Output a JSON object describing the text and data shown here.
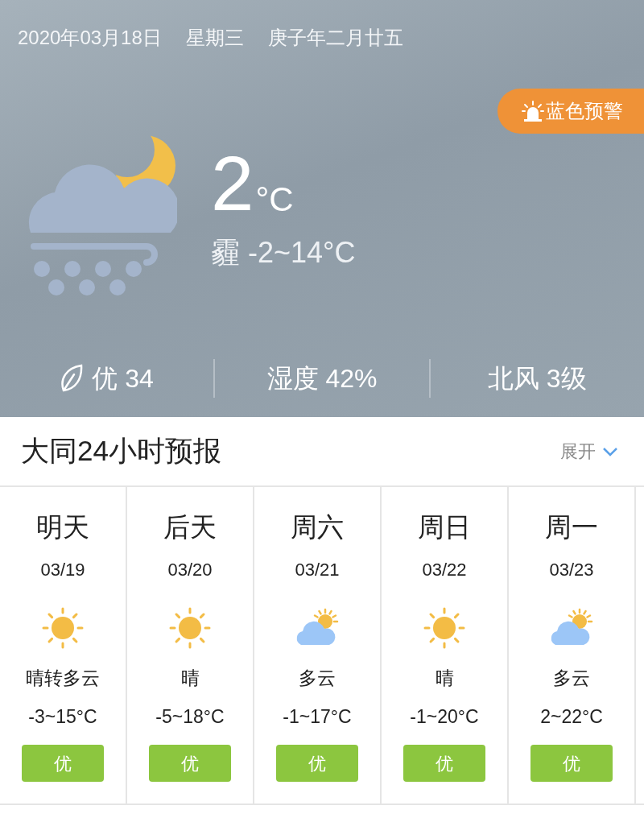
{
  "date_line": {
    "date": "2020年03月18日",
    "weekday": "星期三",
    "lunar": "庚子年二月廿五"
  },
  "alert": {
    "label": "蓝色预警"
  },
  "current": {
    "temperature": "2",
    "unit": "°C",
    "summary": "霾 -2~14°C"
  },
  "stats": [
    {
      "kind": "air",
      "text": "优 34"
    },
    {
      "kind": "plain",
      "text": "湿度 42%"
    },
    {
      "kind": "plain",
      "text": "北风 3级"
    }
  ],
  "forecast": {
    "title": "大同24小时预报",
    "expand_label": "展开",
    "days": [
      {
        "day": "明天",
        "date": "03/19",
        "kind": "sunny",
        "condition": "晴转多云",
        "range": "-3~15°C",
        "aqi": "优",
        "color": "#8cc63f"
      },
      {
        "day": "后天",
        "date": "03/20",
        "kind": "sunny",
        "condition": "晴",
        "range": "-5~18°C",
        "aqi": "优",
        "color": "#8cc63f"
      },
      {
        "day": "周六",
        "date": "03/21",
        "kind": "cloudy",
        "condition": "多云",
        "range": "-1~17°C",
        "aqi": "优",
        "color": "#8cc63f"
      },
      {
        "day": "周日",
        "date": "03/22",
        "kind": "sunny",
        "condition": "晴",
        "range": "-1~20°C",
        "aqi": "优",
        "color": "#8cc63f"
      },
      {
        "day": "周一",
        "date": "03/23",
        "kind": "cloudy",
        "condition": "多云",
        "range": "2~22°C",
        "aqi": "优",
        "color": "#8cc63f"
      }
    ]
  }
}
